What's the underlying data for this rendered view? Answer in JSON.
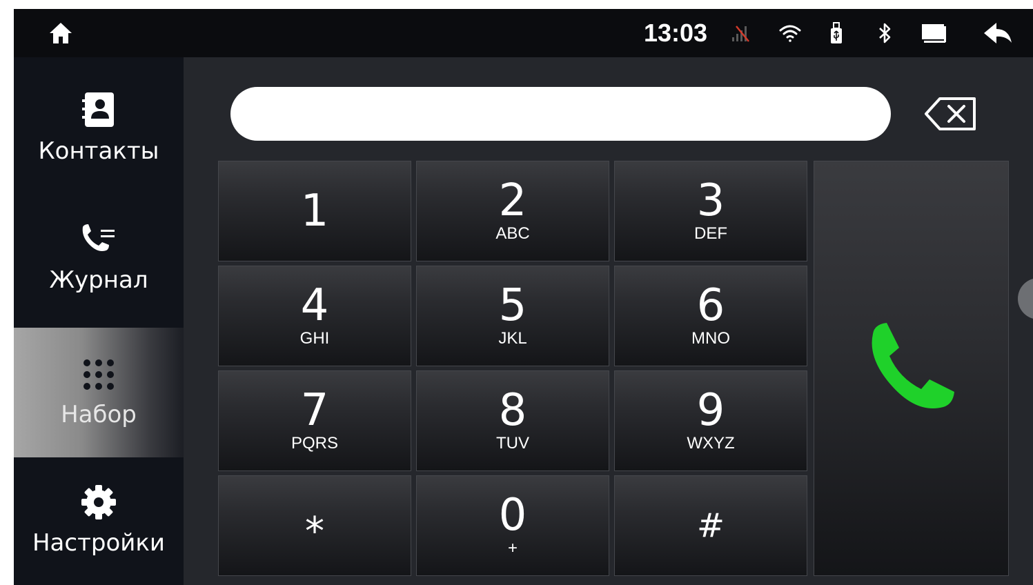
{
  "status_bar": {
    "time": "13:03",
    "icons": [
      "home-icon",
      "no-signal-icon",
      "wifi-icon",
      "usb-icon",
      "bluetooth-icon",
      "screen-icon",
      "back-icon"
    ]
  },
  "sidebar": {
    "items": [
      {
        "label": "Контакты",
        "icon": "contacts-book-icon",
        "active": false
      },
      {
        "label": "Журнал",
        "icon": "call-log-icon",
        "active": false
      },
      {
        "label": "Набор",
        "icon": "dialpad-icon",
        "active": true
      },
      {
        "label": "Настройки",
        "icon": "gear-icon",
        "active": false
      }
    ]
  },
  "dialer": {
    "number_value": "",
    "keys": [
      {
        "digit": "1",
        "letters": ""
      },
      {
        "digit": "2",
        "letters": "ABC"
      },
      {
        "digit": "3",
        "letters": "DEF"
      },
      {
        "digit": "4",
        "letters": "GHI"
      },
      {
        "digit": "5",
        "letters": "JKL"
      },
      {
        "digit": "6",
        "letters": "MNO"
      },
      {
        "digit": "7",
        "letters": "PQRS"
      },
      {
        "digit": "8",
        "letters": "TUV"
      },
      {
        "digit": "9",
        "letters": "WXYZ"
      },
      {
        "digit": "*",
        "letters": ""
      },
      {
        "digit": "0",
        "letters": "+"
      },
      {
        "digit": "#",
        "letters": ""
      }
    ],
    "call_color": "#1fd12a"
  },
  "colors": {
    "background": "#1b1d22",
    "status_bar": "#0b0c0f",
    "sidebar": "#10131a",
    "accent_call": "#1fd12a",
    "no_signal": "#d23a2a"
  }
}
